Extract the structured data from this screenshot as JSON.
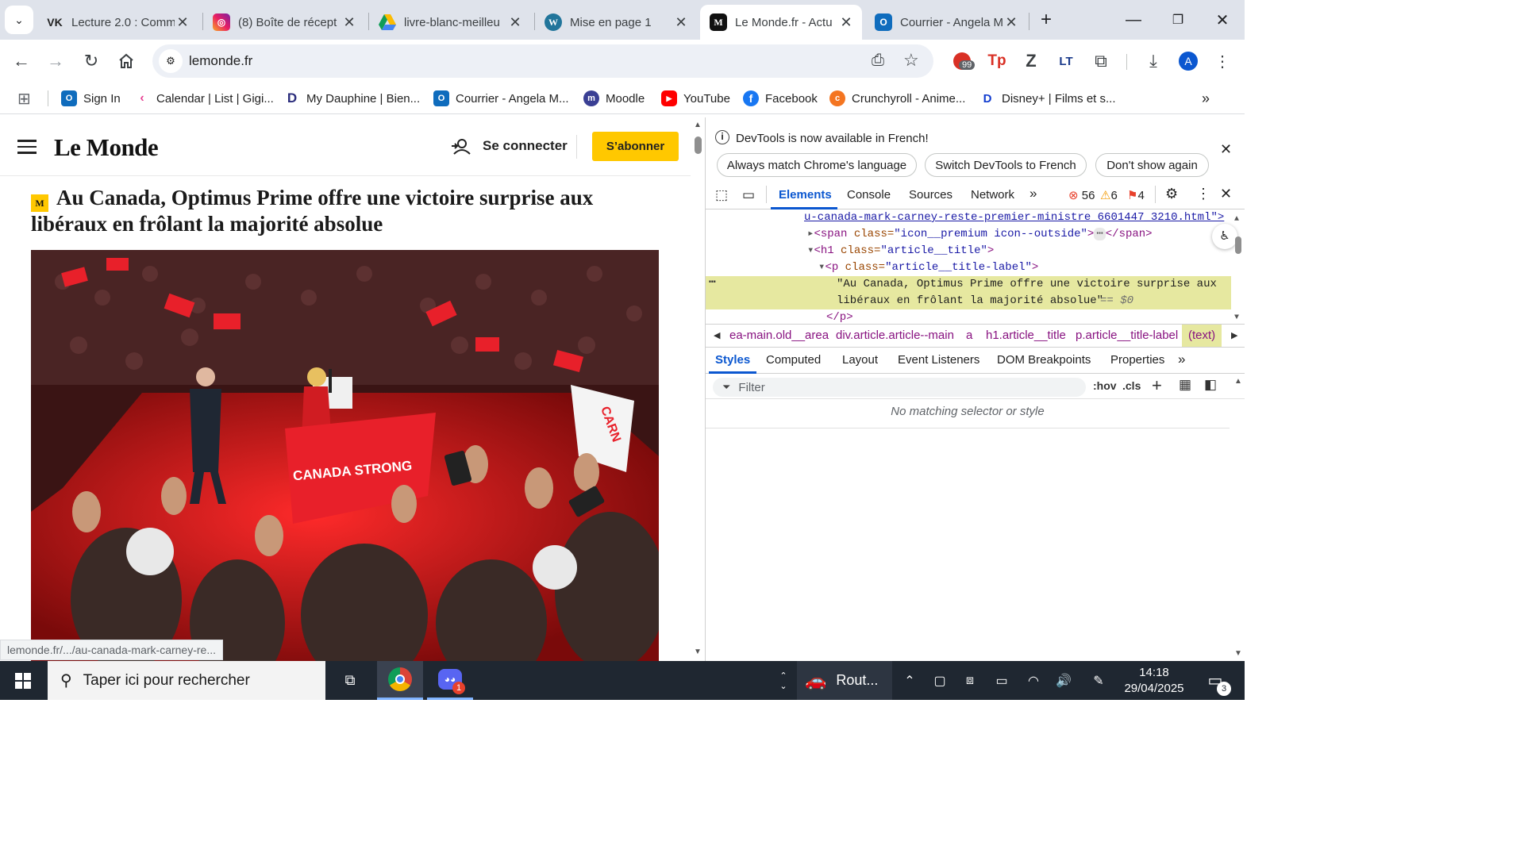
{
  "browser": {
    "tabs": [
      {
        "title": "Lecture 2.0 : Comm",
        "icon": "VK"
      },
      {
        "title": "(8) Boîte de récept",
        "icon": "instagram"
      },
      {
        "title": "livre-blanc-meilleu",
        "icon": "drive"
      },
      {
        "title": "Mise en page 1",
        "icon": "wordpress"
      },
      {
        "title": "Le Monde.fr - Actu",
        "icon": "M"
      },
      {
        "title": "Courrier - Angela M",
        "icon": "outlook"
      }
    ],
    "active_tab_index": 4,
    "url": "lemonde.fr",
    "extension_badge": "99",
    "profile_initial": "A",
    "bookmarks": [
      "Sign In",
      "Calendar | List | Gigi...",
      "My Dauphine | Bien...",
      "Courrier - Angela M...",
      "Moodle",
      "YouTube",
      "Facebook",
      "Crunchyroll - Anime...",
      "Disney+ | Films et s..."
    ]
  },
  "page": {
    "logo": "Le Monde",
    "connect_label": "Se connecter",
    "subscribe_label": "S’abonner",
    "headline": "Au Canada, Optimus Prime offre une victoire surprise aux libéraux en frôlant la majorité absolue",
    "premium_icon": "M",
    "photo_sign": "CANADA STRONG",
    "status_url": "lemonde.fr/.../au-canada-mark-carney-re..."
  },
  "devtools": {
    "info_message": "DevTools is now available in French!",
    "info_buttons": [
      "Always match Chrome's language",
      "Switch DevTools to French",
      "Don't show again"
    ],
    "tabs": [
      "Elements",
      "Console",
      "Sources",
      "Network"
    ],
    "errors": "56",
    "warnings": "6",
    "issues": "4",
    "dom": {
      "line1": "u-canada-mark-carney-reste-premier-ministre_6601447_3210.html\">",
      "line2_tag_open": "<span ",
      "line2_attr": "class=",
      "line2_val": "\"icon__premium icon--outside\"",
      "line2_rest": "</span>",
      "line3_tag_open": "<h1 ",
      "line3_attr": "class=",
      "line3_val": "\"article__title\"",
      "line4_tag_open": "<p ",
      "line4_attr": "class=",
      "line4_val": "\"article__title-label\"",
      "text_line1": "\"Au Canada, Optimus Prime offre une victoire surprise aux",
      "text_line2": "libéraux en frôlant la majorité absolue\"",
      "selected_marker": "== $0",
      "close_p": "</p>"
    },
    "breadcrumbs": [
      "ea-main.old__area",
      "div.article.article--main",
      "a",
      "h1.article__title",
      "p.article__title-label",
      "(text)"
    ],
    "styles_tabs": [
      "Styles",
      "Computed",
      "Layout",
      "Event Listeners",
      "DOM Breakpoints",
      "Properties"
    ],
    "filter_placeholder": "Filter",
    "hov": ":hov",
    "cls": ".cls",
    "no_match": "No matching selector or style"
  },
  "taskbar": {
    "search_placeholder": "Taper ici pour rechercher",
    "weather": "Rout...",
    "time": "14:18",
    "date": "29/04/2025",
    "notifications": "3",
    "discord_badge": "1"
  },
  "colors": {
    "subscribe": "#ffc800",
    "active_tab": "#ffffff",
    "tabstrip": "#dfe3eb",
    "selected_dom": "#e6e8a0",
    "error": "#e8412c",
    "warning": "#f29900"
  }
}
